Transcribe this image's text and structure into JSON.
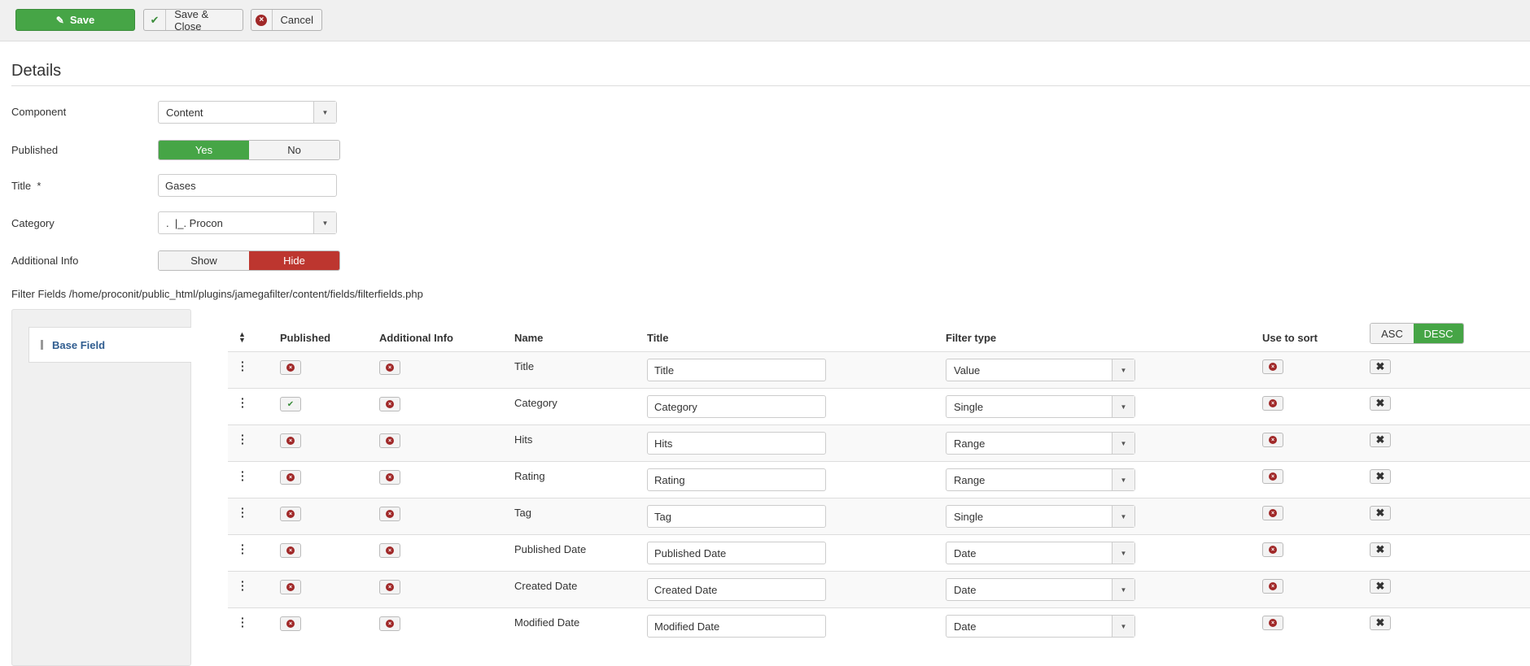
{
  "toolbar": {
    "save": "Save",
    "save_close": "Save & Close",
    "cancel": "Cancel"
  },
  "details": {
    "title": "Details",
    "component_label": "Component",
    "component_value": "Content",
    "published_label": "Published",
    "published_yes": "Yes",
    "published_no": "No",
    "title_label": "Title",
    "required_mark": "*",
    "title_value": "Gases",
    "category_label": "Category",
    "category_value": ".  |_. Procon",
    "addinfo_label": "Additional Info",
    "addinfo_show": "Show",
    "addinfo_hide": "Hide",
    "filter_fields_label": "Filter Fields /home/proconit/public_html/plugins/jamegafilter/content/fields/filterfields.php"
  },
  "sidebar": {
    "tab": "Base Field"
  },
  "table": {
    "headers": {
      "published": "Published",
      "additional_info": "Additional Info",
      "name": "Name",
      "title": "Title",
      "filter_type": "Filter type",
      "use_to_sort": "Use to sort"
    },
    "asc": "ASC",
    "desc": "DESC",
    "sort_selected": "DESC",
    "rows": [
      {
        "name": "Title",
        "title": "Title",
        "filter_type": "Value",
        "published": false,
        "additional_info": false,
        "use_to_sort": false
      },
      {
        "name": "Category",
        "title": "Category",
        "filter_type": "Single",
        "published": true,
        "additional_info": false,
        "use_to_sort": false
      },
      {
        "name": "Hits",
        "title": "Hits",
        "filter_type": "Range",
        "published": false,
        "additional_info": false,
        "use_to_sort": false
      },
      {
        "name": "Rating",
        "title": "Rating",
        "filter_type": "Range",
        "published": false,
        "additional_info": false,
        "use_to_sort": false
      },
      {
        "name": "Tag",
        "title": "Tag",
        "filter_type": "Single",
        "published": false,
        "additional_info": false,
        "use_to_sort": false
      },
      {
        "name": "Published Date",
        "title": "Published Date",
        "filter_type": "Date",
        "published": false,
        "additional_info": false,
        "use_to_sort": false
      },
      {
        "name": "Created Date",
        "title": "Created Date",
        "filter_type": "Date",
        "published": false,
        "additional_info": false,
        "use_to_sort": false
      },
      {
        "name": "Modified Date",
        "title": "Modified Date",
        "filter_type": "Date",
        "published": false,
        "additional_info": false,
        "use_to_sort": false
      }
    ]
  },
  "colors": {
    "green": "#46a546",
    "red": "#bd362f",
    "link": "#2f5c8f"
  }
}
